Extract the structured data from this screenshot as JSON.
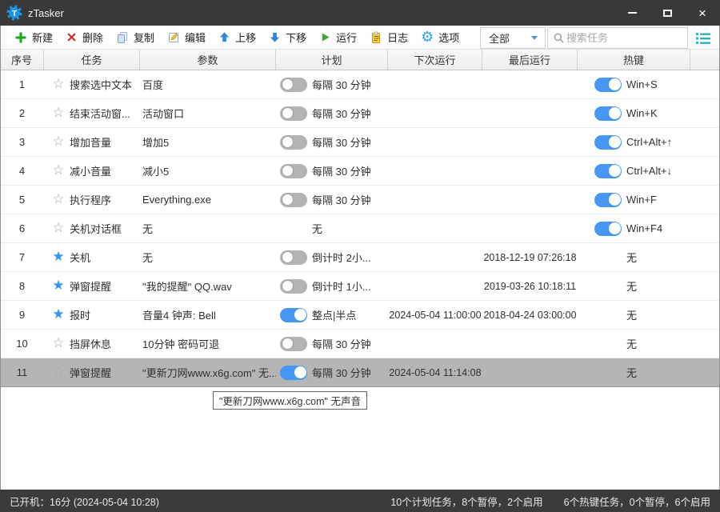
{
  "window": {
    "title": "zTasker"
  },
  "toolbar": {
    "buttons": [
      {
        "id": "new",
        "label": "新建"
      },
      {
        "id": "delete",
        "label": "删除"
      },
      {
        "id": "copy",
        "label": "复制"
      },
      {
        "id": "edit",
        "label": "编辑"
      },
      {
        "id": "move-up",
        "label": "上移"
      },
      {
        "id": "move-down",
        "label": "下移"
      },
      {
        "id": "run",
        "label": "运行"
      },
      {
        "id": "log",
        "label": "日志"
      },
      {
        "id": "options",
        "label": "选项"
      }
    ],
    "filter_value": "全部",
    "search_placeholder": "搜索任务"
  },
  "table": {
    "columns": [
      "序号",
      "任务",
      "参数",
      "计划",
      "下次运行",
      "最后运行",
      "热键"
    ],
    "rows": [
      {
        "num": "1",
        "starred": false,
        "task": "搜索选中文本",
        "params": "百度",
        "schedule": {
          "toggle": "off",
          "text": "每隔 30 分钟"
        },
        "next_run": "",
        "last_run": "",
        "hotkey": {
          "toggle": "on",
          "text": "Win+S"
        },
        "selected": false
      },
      {
        "num": "2",
        "starred": false,
        "task": "结束活动窗...",
        "params": "活动窗口",
        "schedule": {
          "toggle": "off",
          "text": "每隔 30 分钟"
        },
        "next_run": "",
        "last_run": "",
        "hotkey": {
          "toggle": "on",
          "text": "Win+K"
        },
        "selected": false
      },
      {
        "num": "3",
        "starred": false,
        "task": "增加音量",
        "params": "增加5",
        "schedule": {
          "toggle": "off",
          "text": "每隔 30 分钟"
        },
        "next_run": "",
        "last_run": "",
        "hotkey": {
          "toggle": "on",
          "text": "Ctrl+Alt+↑"
        },
        "selected": false
      },
      {
        "num": "4",
        "starred": false,
        "task": "减小音量",
        "params": "减小5",
        "schedule": {
          "toggle": "off",
          "text": "每隔 30 分钟"
        },
        "next_run": "",
        "last_run": "",
        "hotkey": {
          "toggle": "on",
          "text": "Ctrl+Alt+↓"
        },
        "selected": false
      },
      {
        "num": "5",
        "starred": false,
        "task": "执行程序",
        "params": "Everything.exe",
        "schedule": {
          "toggle": "off",
          "text": "每隔 30 分钟"
        },
        "next_run": "",
        "last_run": "",
        "hotkey": {
          "toggle": "on",
          "text": "Win+F"
        },
        "selected": false
      },
      {
        "num": "6",
        "starred": false,
        "task": "关机对话框",
        "params": "无",
        "schedule": {
          "toggle": null,
          "text": "无"
        },
        "next_run": "",
        "last_run": "",
        "hotkey": {
          "toggle": "on",
          "text": "Win+F4"
        },
        "selected": false
      },
      {
        "num": "7",
        "starred": true,
        "task": "关机",
        "params": "无",
        "schedule": {
          "toggle": "off",
          "text": "倒计时 2小..."
        },
        "next_run": "",
        "last_run": "2018-12-19 07:26:18",
        "hotkey": {
          "toggle": null,
          "text": "无"
        },
        "selected": false
      },
      {
        "num": "8",
        "starred": true,
        "task": "弹窗提醒",
        "params": "\"我的提醒\" QQ.wav",
        "schedule": {
          "toggle": "off",
          "text": "倒计时 1小..."
        },
        "next_run": "",
        "last_run": "2019-03-26 10:18:11",
        "hotkey": {
          "toggle": null,
          "text": "无"
        },
        "selected": false
      },
      {
        "num": "9",
        "starred": true,
        "task": "报时",
        "params": "音量4 钟声: Bell",
        "schedule": {
          "toggle": "on",
          "text": "整点|半点"
        },
        "next_run": "2024-05-04 11:00:00",
        "last_run": "2018-04-24 03:00:00",
        "hotkey": {
          "toggle": null,
          "text": "无"
        },
        "selected": false
      },
      {
        "num": "10",
        "starred": false,
        "task": "挡屏休息",
        "params": "10分钟 密码可退",
        "schedule": {
          "toggle": "off",
          "text": "每隔 30 分钟"
        },
        "next_run": "",
        "last_run": "",
        "hotkey": {
          "toggle": null,
          "text": "无"
        },
        "selected": false
      },
      {
        "num": "11",
        "starred": false,
        "task": "弹窗提醒",
        "params": "\"更新刀网www.x6g.com\" 无...",
        "schedule": {
          "toggle": "on",
          "text": "每隔 30 分钟"
        },
        "next_run": "2024-05-04 11:14:08",
        "last_run": "",
        "hotkey": {
          "toggle": null,
          "text": "无"
        },
        "selected": true
      }
    ]
  },
  "tooltip": {
    "text": "\"更新刀网www.x6g.com\" 无声音"
  },
  "statusbar": {
    "left": "已开机：16分 (2024-05-04 10:28)",
    "plan_summary": "10个计划任务，8个暂停，2个启用",
    "hotkey_summary": "6个热键任务，0个暂停，6个启用"
  },
  "colors": {
    "accent": "#4596f5",
    "star_filled": "#2f96f3",
    "toggle_off": "#b4b4b4",
    "selected_row": "#b5b5b5",
    "titlebar": "#393939",
    "list_icon": "#28b2c8"
  }
}
